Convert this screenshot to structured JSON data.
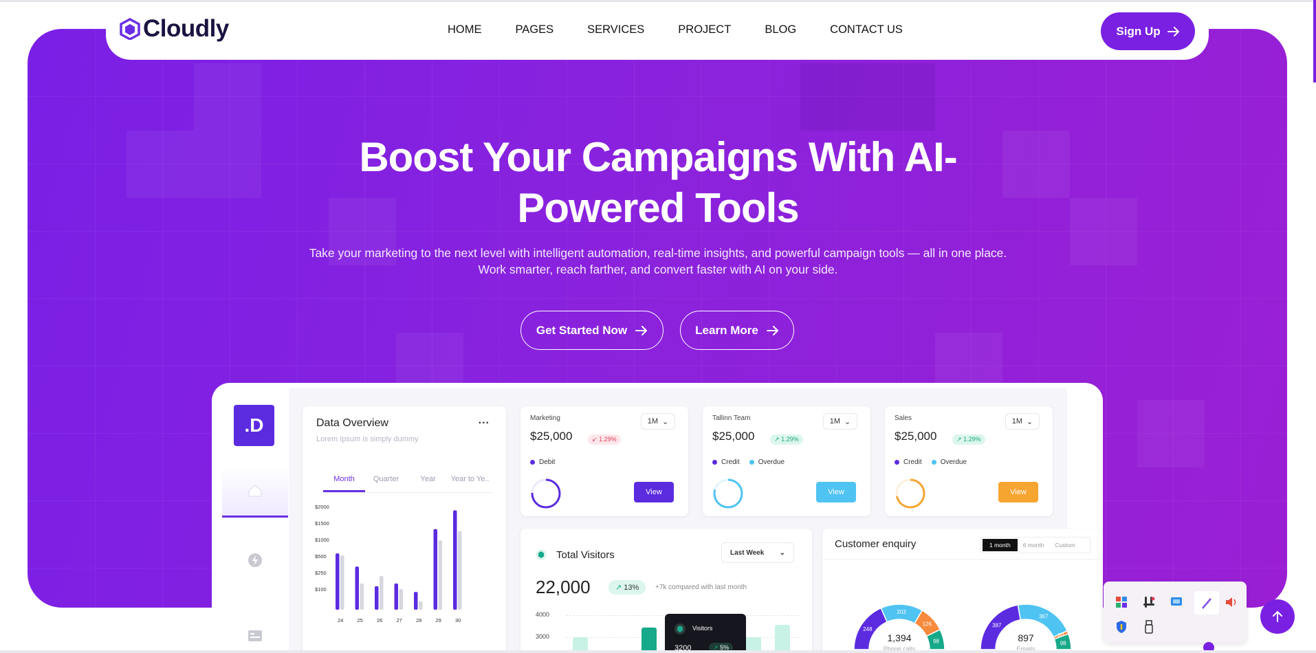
{
  "brand": {
    "name": "Cloudly",
    "accent": "#7a20e3"
  },
  "nav": {
    "items": [
      "HOME",
      "PAGES",
      "SERVICES",
      "PROJECT",
      "BLOG",
      "CONTACT US"
    ],
    "signup_label": "Sign Up"
  },
  "hero": {
    "title_line1": "Boost Your Campaigns With AI-",
    "title_line2": "Powered Tools",
    "subtitle_line1": "Take your marketing to the next level with intelligent automation, real-time insights, and powerful campaign tools — all in one place.",
    "subtitle_line2": "Work smarter, reach farther, and convert faster with AI on your side.",
    "primary_cta": "Get Started Now",
    "secondary_cta": "Learn More"
  },
  "dashboard": {
    "side_logo": ".D",
    "overview": {
      "title": "Data Overview",
      "subtitle": "Lorem Ipsum is simply dummy",
      "more": "...",
      "tabs": [
        "Month",
        "Quarter",
        "Year",
        "Year to Ye.."
      ],
      "active_tab": "Month"
    },
    "stat_cards": [
      {
        "label": "Marketing",
        "value": "$25,000",
        "change": "1.29%",
        "trend": "down",
        "period": "1M",
        "legend": [
          "Debit"
        ],
        "button": "View",
        "button_color": "#5b2be0",
        "ring_color": "#5b2be0"
      },
      {
        "label": "Tallinn Team",
        "value": "$25,000",
        "change": "1.29%",
        "trend": "up",
        "period": "1M",
        "legend": [
          "Credit",
          "Overdue"
        ],
        "button": "View",
        "button_color": "#4fc3f2",
        "ring_color": "#4fc3f2"
      },
      {
        "label": "Sales",
        "value": "$25,000",
        "change": "1.29%",
        "trend": "up",
        "period": "1M",
        "legend": [
          "Credit",
          "Overdue"
        ],
        "button": "View",
        "button_color": "#f7a531",
        "ring_color": "#f7a531"
      }
    ],
    "visitors": {
      "title": "Total Visitors",
      "range": "Last Week",
      "value": "22,000",
      "change": "13%",
      "compare": "+7k compared with last month",
      "y_ticks": [
        "4000",
        "3000"
      ],
      "tooltip_label": "Visitors",
      "tooltip_value": "3200",
      "tooltip_change": "5%"
    },
    "enquiry": {
      "title": "Customer enquiry",
      "tabs": [
        "1 month",
        "6 month",
        "Custom"
      ],
      "active_tab": "1 month",
      "gauges": [
        {
          "total": "1,394",
          "label": "Phone calls",
          "segments": [
            {
              "value": 248,
              "color": "#5b2be0"
            },
            {
              "value": 203,
              "color": "#4fc3f2"
            },
            {
              "value": 126,
              "color": "#f78a3c"
            },
            {
              "value": 98,
              "color": "#16a98a"
            }
          ]
        },
        {
          "total": "897",
          "label": "Emails",
          "segments": [
            {
              "value": 387,
              "color": "#5b2be0"
            },
            {
              "value": 367,
              "color": "#4fc3f2"
            },
            {
              "value": 20,
              "color": "#f78a3c"
            },
            {
              "value": 98,
              "color": "#16a98a"
            }
          ]
        }
      ]
    }
  },
  "chart_data": {
    "type": "bar",
    "categories": [
      "24",
      "25",
      "26",
      "27",
      "28",
      "29",
      "30"
    ],
    "y_ticks": [
      "$2000",
      "$1500",
      "$1000",
      "$500",
      "$250",
      "$100"
    ],
    "series": [
      {
        "values": [
          6,
          4.6,
          2.5,
          2.8,
          1.9,
          8.6,
          10.6
        ],
        "color": "#5b2be0"
      },
      {
        "values": [
          5.8,
          2.8,
          3.6,
          2.2,
          0.9,
          7.4,
          8.4
        ],
        "color": "#d7d7e0"
      }
    ]
  },
  "tray": {
    "icons": [
      "colorful-app-icon",
      "slack-icon",
      "monitor-icon",
      "pen-icon",
      "speaker-icon",
      "shield-icon",
      "usb-icon"
    ]
  }
}
